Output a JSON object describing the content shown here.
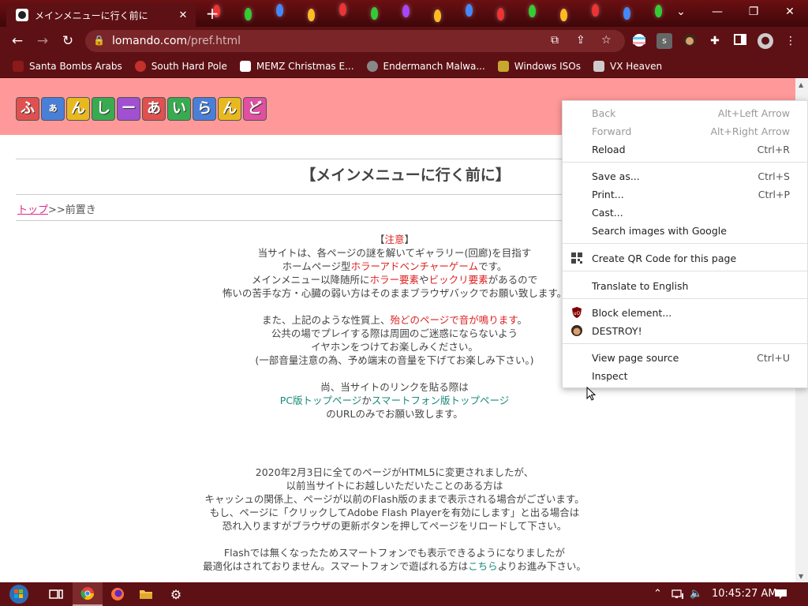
{
  "tab": {
    "title": "メインメニューに行く前に",
    "close": "✕",
    "new_tab": "+"
  },
  "window": {
    "chevron": "⌄",
    "minimize": "—",
    "restore": "❐",
    "close": "✕"
  },
  "toolbar": {
    "back": "←",
    "forward": "→",
    "reload": "↻",
    "url_domain": "lomando.com",
    "url_path": "/pref.html",
    "icons": [
      "translate-icon",
      "share-icon",
      "bookmark-star-icon",
      "extension-flag-icon",
      "extension-s-icon",
      "extension-avatar-icon",
      "extensions-puzzle-icon",
      "sidepanel-icon",
      "profile-icon",
      "menu-kebab-icon"
    ]
  },
  "bookmarks": [
    {
      "label": "Santa Bombs Arabs",
      "color": "#8b1a1a"
    },
    {
      "label": "South Hard Pole",
      "color": "#c4302b"
    },
    {
      "label": "MEMZ Christmas E...",
      "color": "#ffffff"
    },
    {
      "label": "Endermanch Malwa...",
      "color": "#888888"
    },
    {
      "label": "Windows ISOs",
      "color": "#c8a630"
    },
    {
      "label": "VX Heaven",
      "color": "#cccccc"
    }
  ],
  "page": {
    "logo_chars": [
      "ふ",
      "ぁ",
      "ん",
      "し",
      "ー",
      "あ",
      "い",
      "ら",
      "ん",
      "ど"
    ],
    "title": "【メインメニューに行く前に】",
    "breadcrumb_link": "トップ",
    "breadcrumb_rest": ">>前置き",
    "notice_label": "注意",
    "p1_line1": "当サイトは、各ページの謎を解いてギャラリー(回廊)を目指す",
    "p1_line2_a": "ホームページ型",
    "p1_line2_red": "ホラーアドベンチャーゲーム",
    "p1_line2_b": "です。",
    "p1_line3_a": "メインメニュー以降随所に",
    "p1_line3_red1": "ホラー要素",
    "p1_line3_mid": "や",
    "p1_line3_red2": "ビックリ要素",
    "p1_line3_b": "があるので",
    "p1_line4": "怖いの苦手な方・心臓の弱い方はそのままブラウザバックでお願い致します。",
    "p2_line1_a": "また、上記のような性質上、",
    "p2_line1_red": "殆どのページで音が鳴ります",
    "p2_line1_b": "。",
    "p2_line2": "公共の場でプレイする際は周囲のご迷惑にならないよう",
    "p2_line3": "イヤホンをつけてお楽しみください。",
    "p2_line4": "(一部音量注意の為、予め端末の音量を下げてお楽しみ下さい。)",
    "p3_line1": "尚、当サイトのリンクを貼る際は",
    "p3_line2_teal1": "PC版トップページ",
    "p3_line2_mid": "か",
    "p3_line2_teal2": "スマートフォン版トップページ",
    "p3_line3": "のURLのみでお願い致します。",
    "p4_line1": "2020年2月3日に全てのページがHTML5に変更されましたが、",
    "p4_line2": "以前当サイトにお越しいただいたことのある方は",
    "p4_line3": "キャッシュの関係上、ページが以前のFlash版のままで表示される場合がございます。",
    "p4_line4": "もし、ページに「クリックしてAdobe Flash Playerを有効にします」と出る場合は",
    "p4_line5": "恐れ入りますがブラウザの更新ボタンを押してページをリロードして下さい。",
    "p5_line1": "Flashでは無くなったためスマートフォンでも表示できるようになりましたが",
    "p5_line2_a": "最適化はされておりません。スマートフォンで遊ばれる方は",
    "p5_line2_link": "こちら",
    "p5_line2_b": "よりお進み下さい。"
  },
  "context_menu": {
    "back": {
      "label": "Back",
      "shortcut": "Alt+Left Arrow"
    },
    "forward": {
      "label": "Forward",
      "shortcut": "Alt+Right Arrow"
    },
    "reload": {
      "label": "Reload",
      "shortcut": "Ctrl+R"
    },
    "save_as": {
      "label": "Save as...",
      "shortcut": "Ctrl+S"
    },
    "print": {
      "label": "Print...",
      "shortcut": "Ctrl+P"
    },
    "cast": {
      "label": "Cast..."
    },
    "search_images": {
      "label": "Search images with Google"
    },
    "qr": {
      "label": "Create QR Code for this page"
    },
    "translate": {
      "label": "Translate to English"
    },
    "block": {
      "label": "Block element..."
    },
    "destroy": {
      "label": "DESTROY!"
    },
    "view_source": {
      "label": "View page source",
      "shortcut": "Ctrl+U"
    },
    "inspect": {
      "label": "Inspect"
    }
  },
  "taskbar": {
    "time": "10:45:27 AM",
    "tray_up": "⌃",
    "apps": [
      "start-orb-icon",
      "task-view-icon",
      "chrome-icon",
      "firefox-icon",
      "file-explorer-icon",
      "settings-gear-icon"
    ]
  },
  "colors": {
    "chrome": "#5e1114",
    "header_band": "#ff9999",
    "red_text": "#dd2222",
    "teal_text": "#1a8a7a",
    "link_pink": "#e0288a"
  }
}
